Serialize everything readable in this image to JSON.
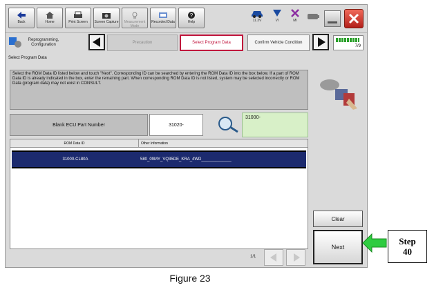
{
  "toolbar": {
    "buttons": [
      {
        "label": "Back",
        "icon": "home-back-icon"
      },
      {
        "label": "Home",
        "icon": "home-icon"
      },
      {
        "label": "Print Screen",
        "icon": "printer-icon"
      },
      {
        "label": "Screen Capture",
        "icon": "camera-icon"
      },
      {
        "label": "Measurement Mode",
        "icon": "measurement-icon"
      },
      {
        "label": "Recorded Data",
        "icon": "recorded-data-icon"
      },
      {
        "label": "Help",
        "icon": "help-icon"
      }
    ],
    "status": {
      "voltage": "11.3V",
      "vi_label": "VI",
      "mi_label": "MI"
    }
  },
  "breadcrumb": {
    "step1": "Reprogramming, Configuration",
    "step2": "Precaution",
    "step3": "Select Program Data",
    "step4": "Confirm Vehicle Condition",
    "page": "7/9"
  },
  "section_title": "Select Program Data",
  "instructions": "Select the ROM Data ID listed below and touch \"Next\". Corresponding ID can be searched by entering the ROM Data ID into the box below. If a part of ROM Data ID is already indicated in the box, enter the remaining part. When corresponding ROM Data ID is not listed, system may be selected incorrectly or ROM Data (program data) may not exist in CONSULT.",
  "part_number": {
    "label": "Blank ECU Part Number",
    "value": "31020-",
    "search_value": "31000-"
  },
  "table": {
    "headers": [
      "ROM Data ID",
      "Other Information"
    ],
    "rows": [
      {
        "rom_id": "31000-CL80A",
        "info": "580_09MY_VQ35DE_KRA_4WD_____________"
      }
    ]
  },
  "pagination": "1/1",
  "buttons": {
    "clear": "Clear",
    "next": "Next"
  },
  "callout": {
    "text": "Step 40",
    "arrow_color": "#2ecc40"
  },
  "caption": "Figure 23",
  "colors": {
    "selected_row": "#1c2a6e",
    "active_crumb": "#c0143c",
    "search_box": "#d8f0c8"
  }
}
